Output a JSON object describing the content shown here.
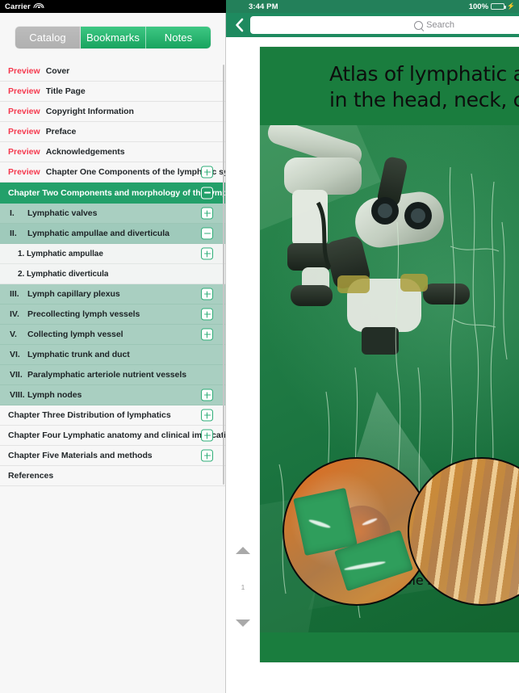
{
  "left_status": {
    "carrier": "Carrier",
    "wifi_icon": "wifi-icon"
  },
  "segmented": {
    "items": [
      {
        "label": "Catalog",
        "selected": true
      },
      {
        "label": "Bookmarks",
        "selected": false
      },
      {
        "label": "Notes",
        "selected": false
      }
    ]
  },
  "toc": {
    "preview_label": "Preview",
    "rows": [
      {
        "level": "front",
        "preview": true,
        "label": "Cover"
      },
      {
        "level": "front",
        "preview": true,
        "label": "Title Page"
      },
      {
        "level": "front",
        "preview": true,
        "label": "Copyright Information"
      },
      {
        "level": "front",
        "preview": true,
        "label": "Preface"
      },
      {
        "level": "front",
        "preview": true,
        "label": "Acknowledgements"
      },
      {
        "level": "front",
        "preview": true,
        "label": "Chapter One Components of the lymphatic syste",
        "button": "plus"
      },
      {
        "level": "chapter-open",
        "preview": false,
        "label": "Chapter Two Components and morphology of the lymph",
        "button": "minus"
      },
      {
        "level": "lvl1",
        "roman": "I.",
        "label": "Lymphatic valves",
        "button": "plus"
      },
      {
        "level": "lvl1-open",
        "roman": "II.",
        "label": "Lymphatic ampullae and diverticula",
        "button": "minus"
      },
      {
        "level": "lvl2",
        "label": "1. Lymphatic ampullae",
        "button": "plus"
      },
      {
        "level": "lvl2",
        "label": "2. Lymphatic diverticula"
      },
      {
        "level": "lvl1",
        "roman": "III.",
        "label": "Lymph capillary plexus",
        "button": "plus"
      },
      {
        "level": "lvl1",
        "roman": "IV.",
        "label": "Precollecting lymph vessels",
        "button": "plus"
      },
      {
        "level": "lvl1",
        "roman": "V.",
        "label": "Collecting lymph vessel",
        "button": "plus"
      },
      {
        "level": "lvl1",
        "roman": "VI.",
        "label": "Lymphatic trunk and duct"
      },
      {
        "level": "lvl1",
        "roman": "VII.",
        "label": "Paralymphatic arteriole nutrient vessels"
      },
      {
        "level": "lvl1",
        "roman": "VIII.",
        "label": "Lymph nodes",
        "button": "plus"
      },
      {
        "level": "front",
        "preview": false,
        "label": "Chapter Three Distribution of lymphatics",
        "button": "plus"
      },
      {
        "level": "front",
        "preview": false,
        "label": "Chapter Four Lymphatic anatomy and clinical implications",
        "button": "plus"
      },
      {
        "level": "front",
        "preview": false,
        "label": "Chapter Five Materials and methods",
        "button": "plus"
      },
      {
        "level": "front",
        "preview": false,
        "label": "References"
      }
    ]
  },
  "right_status": {
    "time": "3:44 PM",
    "battery_percent": "100%",
    "charging_icon": "charging-bolt-icon"
  },
  "navbar": {
    "back_icon": "back-chevron-icon",
    "search_placeholder": "Search",
    "search_value": "",
    "search_icon": "search-icon"
  },
  "pager": {
    "up_icon": "triangle-up-icon",
    "down_icon": "triangle-down-icon",
    "page_number": "1"
  },
  "cover": {
    "title_line1": "Atlas of lymphatic anatomy",
    "title_line2": "in the head, neck, chest and limbs",
    "publisher": "People’s Medical Publishing House",
    "photo_alt": "surgical-microscope-photo"
  },
  "colors": {
    "brand_green": "#23a06a",
    "navbar_green": "#1e8a5f",
    "statusbar_green": "#23805a",
    "preview_red": "#f5394e",
    "level1_bg": "#a9cfc1",
    "cover_green": "#1a7d3e"
  }
}
